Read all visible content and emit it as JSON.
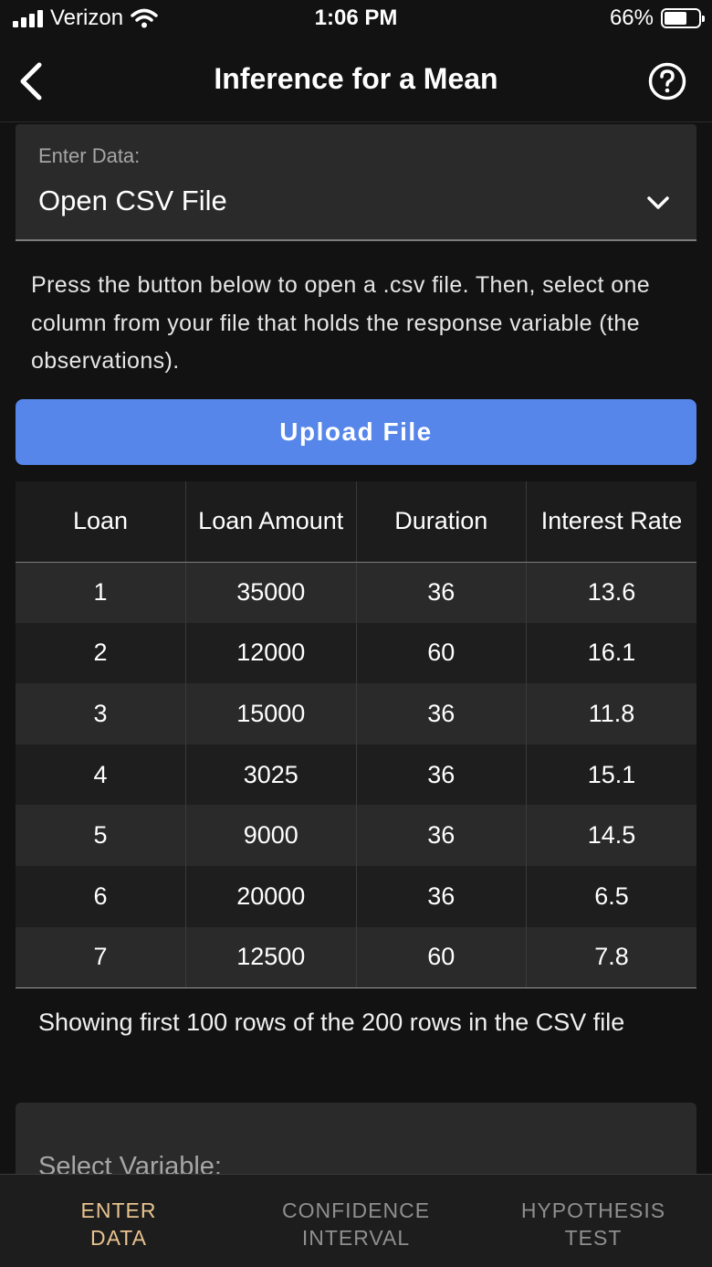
{
  "status_bar": {
    "carrier": "Verizon",
    "time": "1:06 PM",
    "battery_percent": "66%",
    "battery_level": 0.66
  },
  "nav": {
    "title": "Inference for a Mean",
    "back_icon": "chevron-left-icon",
    "help_icon": "question-circle-icon"
  },
  "enter_data": {
    "label": "Enter Data:",
    "selected": "Open CSV File"
  },
  "instructions": "Press the button below to open a .csv file. Then, select one column from your file that holds the response variable (the observations).",
  "upload_button": "Upload File",
  "table": {
    "headers": [
      "Loan",
      "Loan Amount",
      "Duration",
      "Interest Rate"
    ],
    "rows": [
      [
        "1",
        "35000",
        "36",
        "13.6"
      ],
      [
        "2",
        "12000",
        "60",
        "16.1"
      ],
      [
        "3",
        "15000",
        "36",
        "11.8"
      ],
      [
        "4",
        "3025",
        "36",
        "15.1"
      ],
      [
        "5",
        "9000",
        "36",
        "14.5"
      ],
      [
        "6",
        "20000",
        "36",
        "6.5"
      ],
      [
        "7",
        "12500",
        "60",
        "7.8"
      ]
    ]
  },
  "footnote": "Showing first 100 rows of the 200 rows in the CSV file",
  "select_variable": {
    "label": "Select Variable:"
  },
  "tabs": [
    {
      "line1": "ENTER",
      "line2": "DATA",
      "active": true
    },
    {
      "line1": "CONFIDENCE",
      "line2": "INTERVAL",
      "active": false
    },
    {
      "line1": "HYPOTHESIS",
      "line2": "TEST",
      "active": false
    }
  ],
  "colors": {
    "background": "#121212",
    "accent_button": "#5686ea",
    "active_tab": "#e9c38f",
    "inactive_tab": "#8f8f8f"
  }
}
